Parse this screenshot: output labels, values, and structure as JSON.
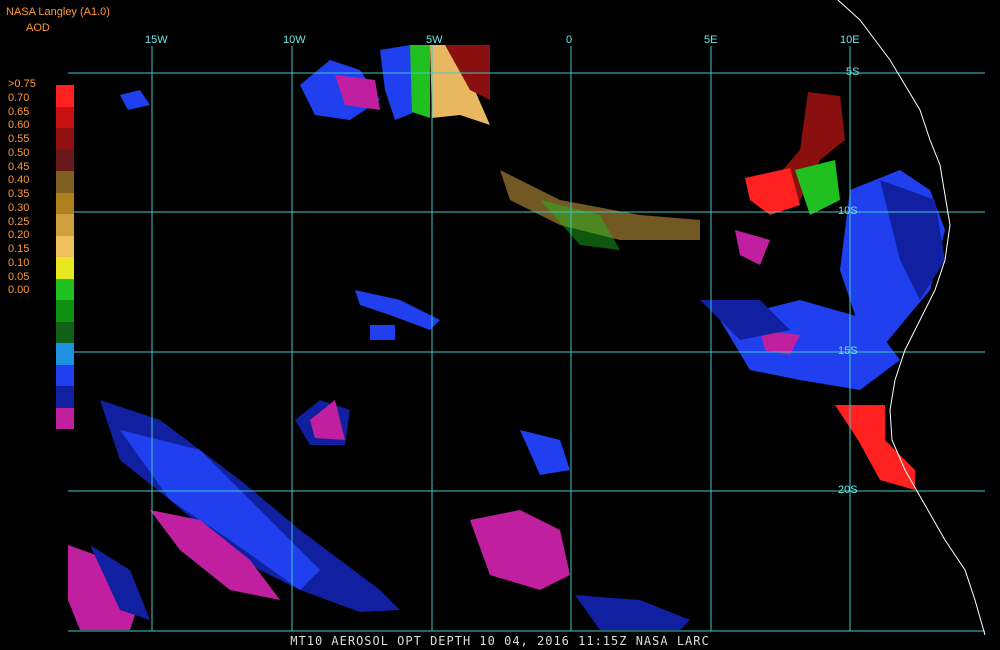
{
  "header": {
    "title": "NASA Langley (A1.0)",
    "unit": "AOD"
  },
  "legend": {
    "labels": [
      ">0.75",
      "0.70",
      "0.65",
      "0.60",
      "0.55",
      "0.50",
      "0.45",
      "0.40",
      "0.35",
      "0.30",
      "0.25",
      "0.20",
      "0.15",
      "0.10",
      "0.05",
      "0.00"
    ],
    "colors": [
      "#ff2020",
      "#c81010",
      "#901010",
      "#681818",
      "#806020",
      "#b08020",
      "#d0a040",
      "#f0c060",
      "#e8e820",
      "#20c020",
      "#109010",
      "#106018",
      "#2090e0",
      "#2040f0",
      "#1020a0",
      "#c020a0"
    ]
  },
  "grid": {
    "lon_labels": [
      "15W",
      "10W",
      "5W",
      "0",
      "5E",
      "10E"
    ],
    "lat_labels": [
      "5S",
      "10S",
      "15S",
      "20S"
    ],
    "line_color": "#40c8c8"
  },
  "footer": {
    "text": "MT10  AEROSOL OPT DEPTH   10 04, 2016 11:15Z   NASA LARC"
  },
  "colors": {
    "magenta": "#c020a0",
    "blue": "#2040f0",
    "darkblue": "#1020a0",
    "lightblue": "#2090e0",
    "green": "#20c020",
    "darkgreen": "#106018",
    "red": "#ff2020",
    "darkred": "#8a1010",
    "orange": "#d0a040",
    "tan": "#e8b860",
    "coast": "#ffffff"
  }
}
